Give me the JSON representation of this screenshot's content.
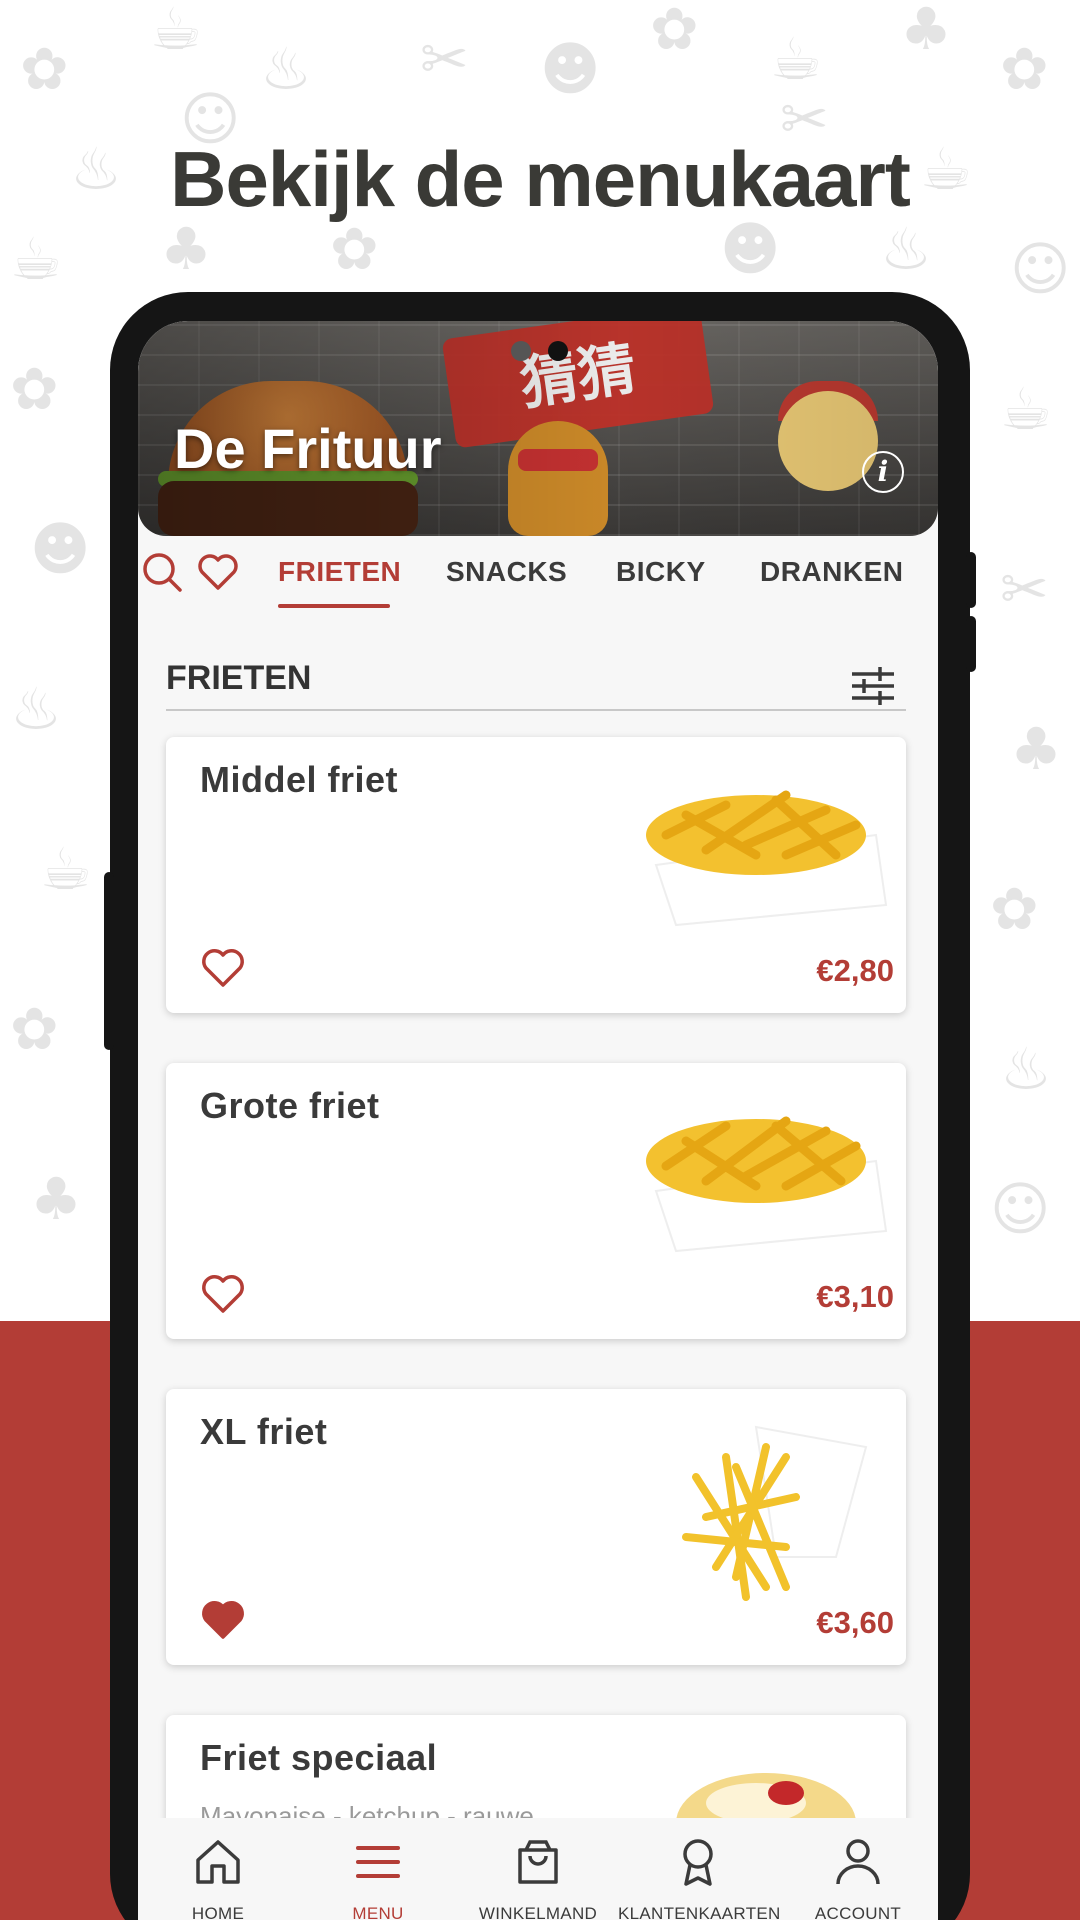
{
  "promo": {
    "headline": "Bekijk de menukaart"
  },
  "restaurant": {
    "name": "De Frituur",
    "banner_sign_text": "猜猜"
  },
  "tabs": [
    {
      "label": "FRIETEN",
      "active": true
    },
    {
      "label": "SNACKS",
      "active": false
    },
    {
      "label": "BICKY",
      "active": false
    },
    {
      "label": "DRANKEN",
      "active": false
    }
  ],
  "section": {
    "title": "FRIETEN"
  },
  "products": [
    {
      "name": "Middel friet",
      "description": "",
      "price": "€2,80",
      "favorite": false
    },
    {
      "name": "Grote friet",
      "description": "",
      "price": "€3,10",
      "favorite": false
    },
    {
      "name": "XL friet",
      "description": "",
      "price": "€3,60",
      "favorite": true
    },
    {
      "name": "Friet speciaal",
      "description": "Mayonaise - ketchup - rauwe",
      "price": "",
      "favorite": false
    }
  ],
  "bottom_nav": [
    {
      "label": "HOME",
      "icon": "home-icon",
      "active": false
    },
    {
      "label": "MENU",
      "icon": "menu-icon",
      "active": true
    },
    {
      "label": "WINKELMAND",
      "icon": "shopping-bag-icon",
      "active": false
    },
    {
      "label": "KLANTENKAARTEN",
      "icon": "award-icon",
      "active": false
    },
    {
      "label": "ACCOUNT",
      "icon": "account-icon",
      "active": false
    }
  ],
  "colors": {
    "accent": "#b33d36",
    "text_dark": "#3a3a3a",
    "screen_bg": "#f7f7f7",
    "phone_frame": "#151515"
  }
}
